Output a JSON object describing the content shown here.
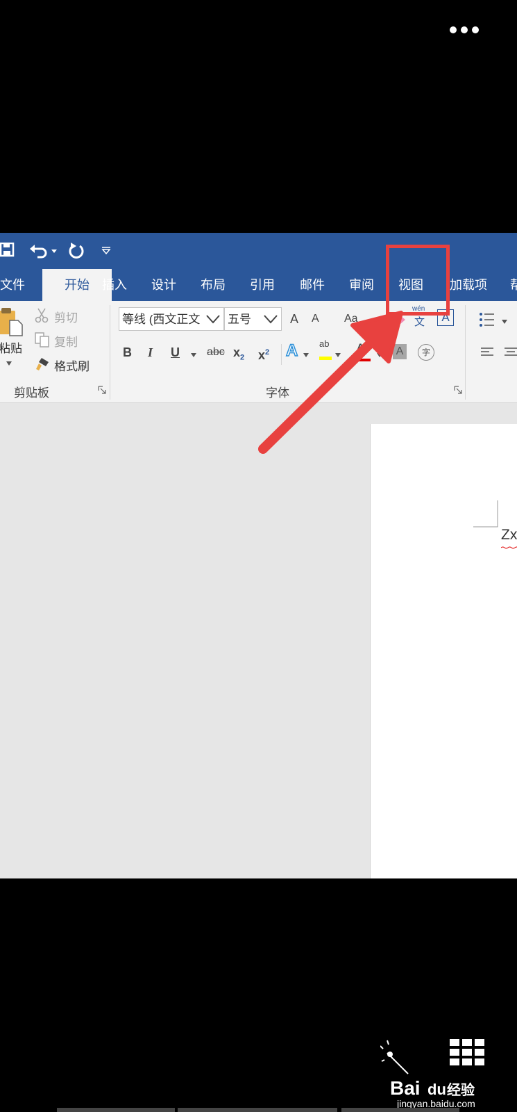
{
  "overlay": {
    "more_button_icon": "more-dots-icon",
    "highlight_color": "#e8413f"
  },
  "word": {
    "accent": "#2b579a",
    "qat": {
      "icons": [
        "save-icon",
        "undo-icon",
        "redo-icon",
        "customize-qat-icon"
      ]
    },
    "tabs": [
      {
        "label": "文件"
      },
      {
        "label": "开始",
        "active": true
      },
      {
        "label": "插入"
      },
      {
        "label": "设计"
      },
      {
        "label": "布局"
      },
      {
        "label": "引用"
      },
      {
        "label": "邮件"
      },
      {
        "label": "审阅"
      },
      {
        "label": "视图",
        "highlighted": true
      },
      {
        "label": "加载项"
      },
      {
        "label": "帮"
      }
    ],
    "clipboard": {
      "paste_label": "粘贴",
      "cut_label": "剪切",
      "copy_label": "复制",
      "format_painter_label": "格式刷",
      "group_label": "剪贴板"
    },
    "font": {
      "font_name": "等线 (西文正文",
      "font_size": "五号",
      "bold": "B",
      "italic": "I",
      "underline": "U",
      "strikethrough": "abc",
      "subscript": "x",
      "subscript_mark": "2",
      "superscript": "x",
      "superscript_mark": "2",
      "grow_font": "A",
      "shrink_font": "A",
      "change_case": "Aa",
      "phonetic_top": "wén",
      "phonetic_bottom": "文",
      "char_border": "A",
      "text_effect": "A",
      "highlight_text": "ab",
      "font_color": "A",
      "char_shading": "A",
      "enclose_char": "字",
      "font_color_value": "#e00000",
      "highlight_color_value": "#ffff00",
      "group_label": "字体"
    },
    "paragraph": {
      "icons": [
        "bullets-icon",
        "align-left-icon",
        "align-center-icon"
      ]
    },
    "document": {
      "text": "Zx"
    }
  },
  "watermark": {
    "brand": "Bai",
    "brand_du": "du",
    "brand_suffix": "经验",
    "url": "jingyan.baidu.com"
  }
}
